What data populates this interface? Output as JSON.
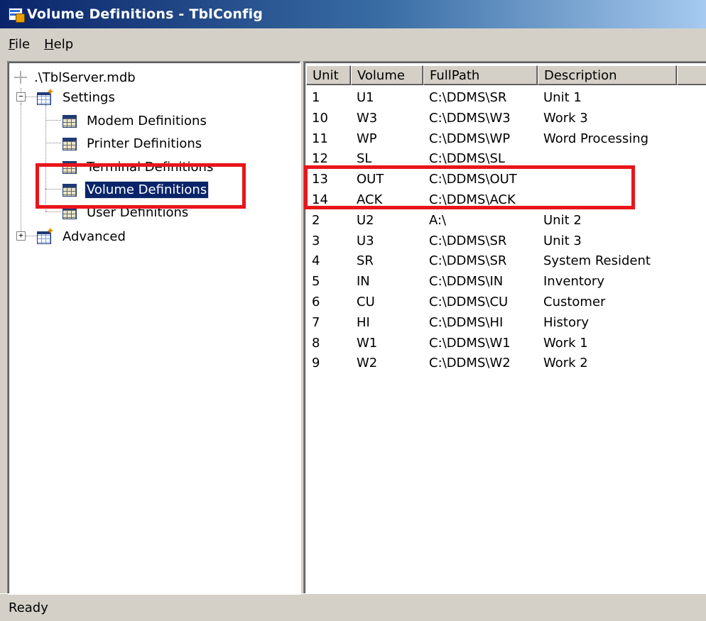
{
  "window": {
    "title": "Volume Definitions - TblConfig"
  },
  "menu": [
    {
      "label": "File",
      "mnemonic": "F",
      "rest": "ile"
    },
    {
      "label": "Help",
      "mnemonic": "H",
      "rest": "elp"
    }
  ],
  "tree": {
    "root": ".\\TblServer.mdb",
    "settings": "Settings",
    "children": [
      "Modem Definitions",
      "Printer Definitions",
      "Terminal Definitions",
      "Volume Definitions",
      "User Definitions"
    ],
    "advanced": "Advanced",
    "selected": "Volume Definitions"
  },
  "table": {
    "columns": [
      "Unit",
      "Volume",
      "FullPath",
      "Description"
    ],
    "rows": [
      [
        "1",
        "U1",
        "C:\\DDMS\\SR",
        "Unit 1"
      ],
      [
        "10",
        "W3",
        "C:\\DDMS\\W3",
        "Work 3"
      ],
      [
        "11",
        "WP",
        "C:\\DDMS\\WP",
        "Word Processing"
      ],
      [
        "12",
        "SL",
        "C:\\DDMS\\SL",
        ""
      ],
      [
        "13",
        "OUT",
        "C:\\DDMS\\OUT",
        ""
      ],
      [
        "14",
        "ACK",
        "C:\\DDMS\\ACK",
        ""
      ],
      [
        "2",
        "U2",
        "A:\\",
        "Unit 2"
      ],
      [
        "3",
        "U3",
        "C:\\DDMS\\SR",
        "Unit 3"
      ],
      [
        "4",
        "SR",
        "C:\\DDMS\\SR",
        "System Resident"
      ],
      [
        "5",
        "IN",
        "C:\\DDMS\\IN",
        "Inventory"
      ],
      [
        "6",
        "CU",
        "C:\\DDMS\\CU",
        "Customer"
      ],
      [
        "7",
        "HI",
        "C:\\DDMS\\HI",
        "History"
      ],
      [
        "8",
        "W1",
        "C:\\DDMS\\W1",
        "Work 1"
      ],
      [
        "9",
        "W2",
        "C:\\DDMS\\W2",
        "Work 2"
      ]
    ]
  },
  "status": {
    "text": "Ready"
  },
  "colors": {
    "highlight": "#e8151b",
    "selection": "#0a246a"
  }
}
